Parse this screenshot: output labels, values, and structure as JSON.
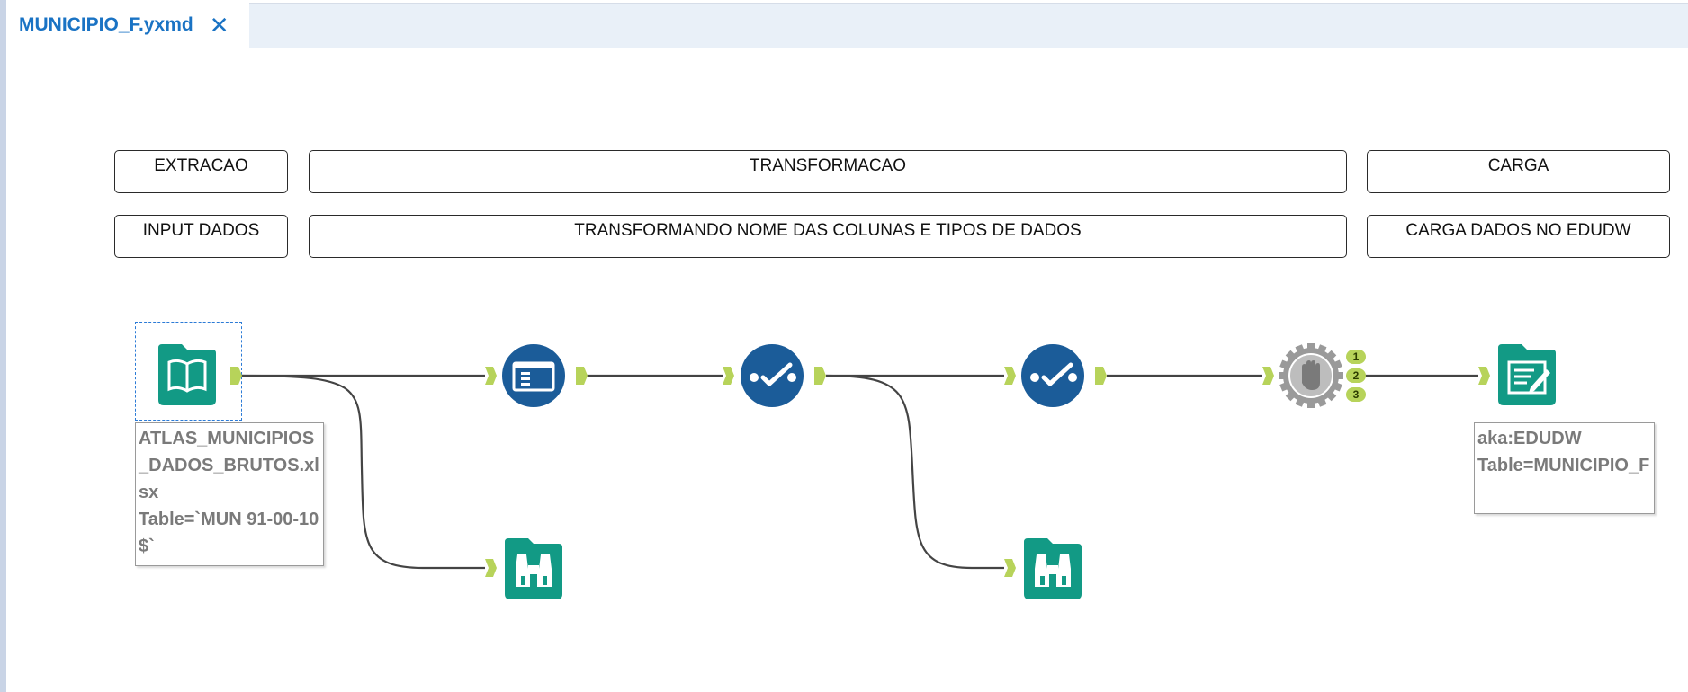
{
  "tab": {
    "title": "MUNICIPIO_F.yxmd",
    "close_glyph": "✕"
  },
  "containers": {
    "extracao": "EXTRACAO",
    "transformacao": "TRANSFORMACAO",
    "carga": "CARGA",
    "input_dados": "INPUT DADOS",
    "transformando": "TRANSFORMANDO NOME DAS COLUNAS E TIPOS DE DADOS",
    "carga_dados": "CARGA DADOS NO EDUDW"
  },
  "tools": [
    {
      "id": "input-data",
      "icon": "book-icon",
      "color": "#129a85"
    },
    {
      "id": "select",
      "icon": "select-icon",
      "color": "#1b5c99"
    },
    {
      "id": "formula-1",
      "icon": "checkmark-icon",
      "color": "#1b5c99"
    },
    {
      "id": "formula-2",
      "icon": "checkmark-icon",
      "color": "#1b5c99"
    },
    {
      "id": "test",
      "icon": "hand-stop-icon",
      "color": "#8a8a8a"
    },
    {
      "id": "output-data",
      "icon": "write-icon",
      "color": "#129a85"
    },
    {
      "id": "browse-1",
      "icon": "binoculars-icon",
      "color": "#129a85"
    },
    {
      "id": "browse-2",
      "icon": "binoculars-icon",
      "color": "#129a85"
    }
  ],
  "annotations": {
    "input": "ATLAS_MUNICIPIOS_DADOS_BRUTOS.xlsx\nTable=`MUN 91-00-10$`",
    "output": "aka:EDUDW\nTable=MUNICIPIO_F"
  },
  "test_outputs": [
    "1",
    "2",
    "3"
  ],
  "colors": {
    "tab_accent": "#1a73c4",
    "connector_anchor": "#b7d35a",
    "wire": "#444444"
  }
}
